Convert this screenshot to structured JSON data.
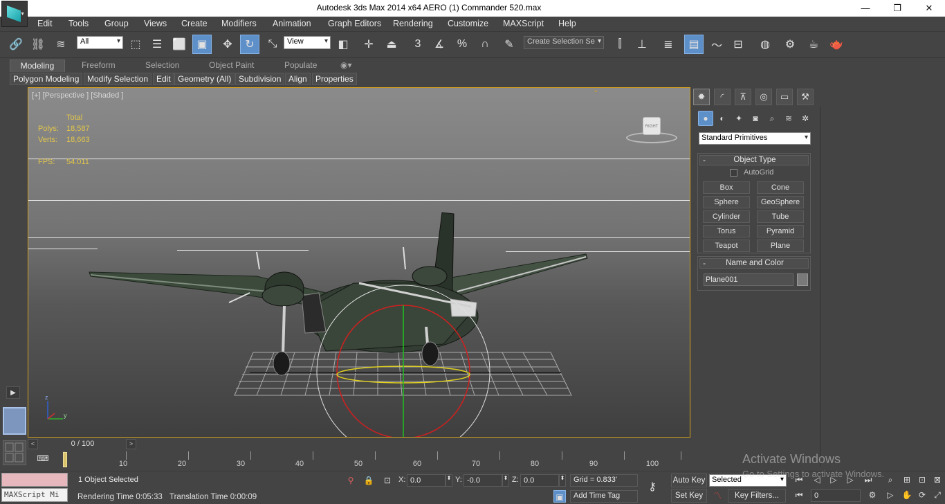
{
  "window": {
    "title": "Autodesk 3ds Max  2014 x64     AERO (1) Commander 520.max",
    "minimize": "—",
    "maximize": "❐",
    "close": "✕"
  },
  "menu": [
    "Edit",
    "Tools",
    "Group",
    "Views",
    "Create",
    "Modifiers",
    "Animation",
    "Graph Editors",
    "Rendering",
    "Customize",
    "MAXScript",
    "Help"
  ],
  "toolbar": {
    "filter_value": "All",
    "refcoord_value": "View",
    "selection_set_placeholder": "Create Selection Se",
    "snap_label": "3",
    "angle_snap_label": "",
    "percent_snap_label": "%"
  },
  "ribbon": {
    "tabs": [
      "Modeling",
      "Freeform",
      "Selection",
      "Object Paint",
      "Populate"
    ],
    "active_tab": "Modeling",
    "commands": [
      "Polygon Modeling",
      "Modify Selection",
      "Edit",
      "Geometry (All)",
      "Subdivision",
      "Align",
      "Properties"
    ]
  },
  "viewport": {
    "label": "[+] [Perspective ] [Shaded ]",
    "stats_header": "Total",
    "polys_label": "Polys:",
    "polys_value": "18,587",
    "verts_label": "Verts:",
    "verts_value": "18,663",
    "fps_label": "FPS:",
    "fps_value": "54.011",
    "viewcube_label": "RIGHT",
    "axis_z": "z",
    "axis_y": "y"
  },
  "command_panel": {
    "primitive_type": "Standard Primitives",
    "object_type_title": "Object Type",
    "autogrid_label": "AutoGrid",
    "buttons": [
      "Box",
      "Cone",
      "Sphere",
      "GeoSphere",
      "Cylinder",
      "Tube",
      "Torus",
      "Pyramid",
      "Teapot",
      "Plane"
    ],
    "name_color_title": "Name and Color",
    "object_name": "Plane001",
    "object_color": "#7a7a7a"
  },
  "timeline": {
    "slider_label": "0 / 100",
    "ticks": [
      "10",
      "20",
      "30",
      "40",
      "50",
      "60",
      "70",
      "80",
      "90",
      "100"
    ]
  },
  "status": {
    "maxscript_placeholder": "MAXScript Mi",
    "selection_info": "1 Object Selected",
    "rendering_time": "Rendering Time  0:05:33",
    "translation_time": "Translation Time  0:00:09",
    "x_label": "X:",
    "x_value": "0.0",
    "y_label": "Y:",
    "y_value": "-0.0",
    "z_label": "Z:",
    "z_value": "0.0",
    "grid": "Grid = 0.833'",
    "add_time_tag": "Add Time Tag",
    "auto_key": "Auto Key",
    "set_key": "Set Key",
    "key_mode": "Selected",
    "key_filters": "Key Filters...",
    "frame_value": "0"
  },
  "watermark": {
    "line1": "Activate Windows",
    "line2": "Go to Settings to activate Windows."
  },
  "colors": {
    "viewport_border": "#d8a320",
    "stats_text": "#e2c64a",
    "active_button": "#5d8fc9",
    "aircraft": "#3b4a3b"
  }
}
